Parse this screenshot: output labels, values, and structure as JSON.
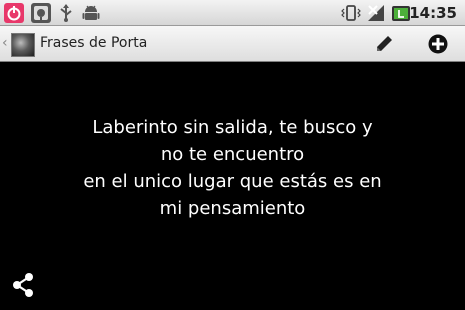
{
  "status_bar": {
    "time": "14:35",
    "left_icons": [
      "power-icon",
      "voice-app-icon",
      "usb-debug-icon",
      "android-icon"
    ],
    "right_icons": [
      "vibrate-icon",
      "signal-icon",
      "battery-icon"
    ]
  },
  "action_bar": {
    "title": "Frases de Porta",
    "edit_icon": "pencil-icon",
    "add_icon": "add-circle-icon"
  },
  "content": {
    "quote_lines": [
      "Laberinto sin salida, te busco y",
      "no te encuentro",
      "en el unico lugar que estás es en",
      "mi pensamiento"
    ],
    "share_icon": "share-icon"
  },
  "colors": {
    "background": "#000000",
    "text": "#ffffff",
    "power_icon": "#e8386a",
    "battery": "#4caf3a"
  }
}
